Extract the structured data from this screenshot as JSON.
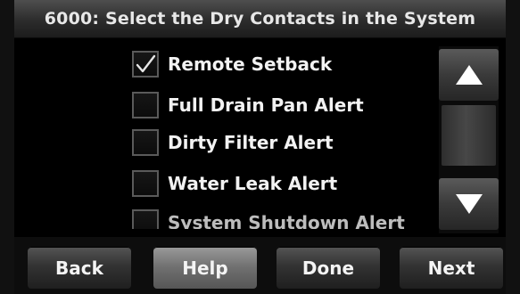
{
  "header": {
    "title": "6000: Select the Dry Contacts in the System"
  },
  "options": [
    {
      "label": "Remote Setback",
      "checked": true
    },
    {
      "label": "Full Drain Pan Alert",
      "checked": false
    },
    {
      "label": "Dirty Filter Alert",
      "checked": false
    },
    {
      "label": "Water Leak Alert",
      "checked": false
    },
    {
      "label": "System Shutdown Alert",
      "checked": false
    }
  ],
  "scroll": {
    "up_icon": "triangle-up",
    "down_icon": "triangle-down"
  },
  "nav": {
    "back_label": "Back",
    "help_label": "Help",
    "done_label": "Done",
    "next_label": "Next"
  },
  "colors": {
    "background": "#000000",
    "text": "#f2f2f2",
    "button_dark": "#333333",
    "button_light": "#6f6f6f"
  }
}
